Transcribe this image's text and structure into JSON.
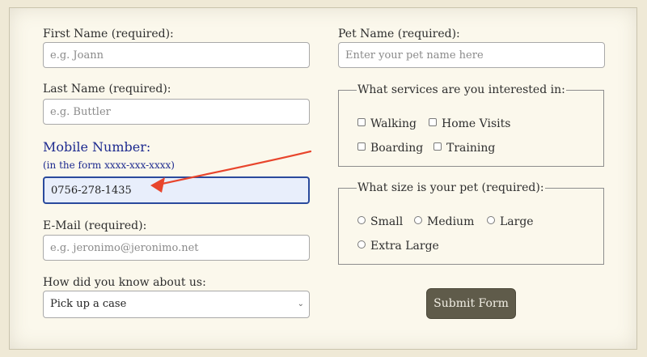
{
  "left_column": {
    "first_name": {
      "label": "First Name (required):",
      "placeholder": "e.g. Joann"
    },
    "last_name": {
      "label": "Last Name (required):",
      "placeholder": "e.g. Buttler"
    },
    "mobile": {
      "label": "Mobile Number:",
      "hint": "(in the form xxxx-xxx-xxxx)",
      "value": "0756-278-1435"
    },
    "email": {
      "label": "E-Mail (required):",
      "placeholder": "e.g. jeronimo@jeronimo.net"
    },
    "referral": {
      "label": "How did you know about us:",
      "selected": "Pick up a case"
    }
  },
  "right_column": {
    "pet_name": {
      "label": "Pet Name (required):",
      "placeholder": "Enter your pet name here"
    },
    "services": {
      "legend": "What services are you interested in:",
      "options": [
        "Walking",
        "Home Visits",
        "Boarding",
        "Training"
      ]
    },
    "size": {
      "legend": "What size is your pet (required):",
      "options": [
        "Small",
        "Medium",
        "Large",
        "Extra Large"
      ]
    },
    "submit_label": "Submit Form"
  },
  "annotation": {
    "arrow_color": "#e8452c"
  },
  "colors": {
    "page_bg": "#efe9d6",
    "panel_bg": "#fbf8ec",
    "accent_blue": "#1d2a8f",
    "active_field_bg": "#e8eefb",
    "button_bg": "#5f5b4a"
  },
  "icons": {
    "select_chevron": "chevron-down-icon",
    "annotation": "arrow-annotation"
  }
}
